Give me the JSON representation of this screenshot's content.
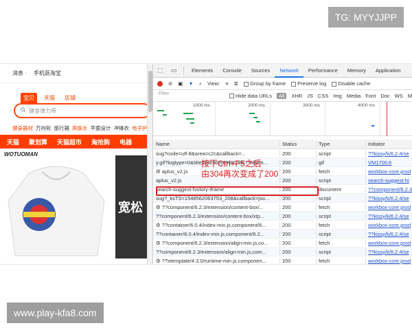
{
  "overlay": {
    "tg": "TG: MYYJJPP",
    "site": "www.play-kfa8.com"
  },
  "taobao": {
    "top_links": [
      "消息 ·",
      "手机逛淘宝"
    ],
    "tabs": [
      "宝贝",
      "天猫",
      "店铺"
    ],
    "search_placeholder": "健身弹力带",
    "categories": [
      "健身器材",
      "万向轮",
      "旅行箱",
      "爽肤水",
      "平面设计",
      "冲锋衣",
      "电子护"
    ],
    "nav": [
      "天猫",
      "聚划算",
      "天猫超市",
      "淘抢购",
      "电器"
    ],
    "brand": "WOTUOMAN",
    "promo_text": "宽松"
  },
  "devtools": {
    "tabs": [
      "Elements",
      "Console",
      "Sources",
      "Network",
      "Performance",
      "Memory",
      "Application"
    ],
    "active_tab": "Network",
    "toolbar": {
      "view_label": "View:",
      "group_by_frame": "Group by frame",
      "preserve_log": "Preserve log",
      "disable_cache": "Disable cache"
    },
    "filter": {
      "placeholder": "Filter",
      "hide_data_urls": "Hide data URLs",
      "types": [
        "All",
        "XHR",
        "JS",
        "CSS",
        "Img",
        "Media",
        "Font",
        "Doc",
        "WS",
        "M"
      ]
    },
    "timeline_labels": [
      "1000 ms",
      "2000 ms",
      "3000 ms",
      "4000 ms"
    ],
    "columns": {
      "name": "Name",
      "status": "Status",
      "type": "Type",
      "initiator": "Initiator"
    },
    "requests": [
      {
        "name": "sug?code=utf-8&area=c2c&callback=...",
        "status": "200",
        "type": "script",
        "initiator": "??kissy/k/6.2.4/se"
      },
      {
        "name": "y.gif?logtype=0&title=%E6%90%9C%E7%B4%...",
        "status": "200",
        "type": "gif",
        "initiator": "VM1700:6"
      },
      {
        "name": "⚙ aplus_v2.js",
        "status": "200",
        "type": "fetch",
        "initiator": "workbox-core.prod"
      },
      {
        "name": "aplus_v2.js",
        "status": "200",
        "type": "script",
        "initiator": "search-suggest-hi"
      },
      {
        "name": "search-suggest-history-iframe",
        "status": "200",
        "type": "document",
        "initiator": "??component/6.2.3"
      },
      {
        "name": "sug?_ksTS=1548562063753_208&callback=jso...",
        "status": "200",
        "type": "script",
        "initiator": "??kissy/k/6.2.4/se"
      },
      {
        "name": "⚙ ??component/6.2.3/extension/content-box/...",
        "status": "200",
        "type": "fetch",
        "initiator": "workbox-core.prod"
      },
      {
        "name": "??component/6.2.3/extension/content-box/xtp...",
        "status": "200",
        "type": "script",
        "initiator": "??kissy/k/6.2.4/se"
      },
      {
        "name": "⚙ ??container/6.0.4/index-min.js,component/6...",
        "status": "200",
        "type": "fetch",
        "initiator": "workbox-core.prod"
      },
      {
        "name": "??container/6.0.4/index-min.js,component/6.2...",
        "status": "200",
        "type": "script",
        "initiator": "??kissy/k/6.2.4/se"
      },
      {
        "name": "⚙ ??component/6.2.3/extension/align-min.js,co...",
        "status": "200",
        "type": "fetch",
        "initiator": "workbox-core.prod"
      },
      {
        "name": "??component/6.2.3/extension/align-min.js,com...",
        "status": "200",
        "type": "script",
        "initiator": "??kissy/k/6.2.4/se"
      },
      {
        "name": "⚙ ??xtemplate/4.3.0/runtime-min.js,componen...",
        "status": "200",
        "type": "fetch",
        "initiator": "workbox-core.prod"
      }
    ]
  },
  "annotation": {
    "line1": "按下Ctrl+F5之后",
    "line2": "由304再次变成了200"
  },
  "colors": {
    "accent": "#ff4400",
    "devtools_blue": "#1a73e8",
    "annotation_red": "#d62020"
  }
}
